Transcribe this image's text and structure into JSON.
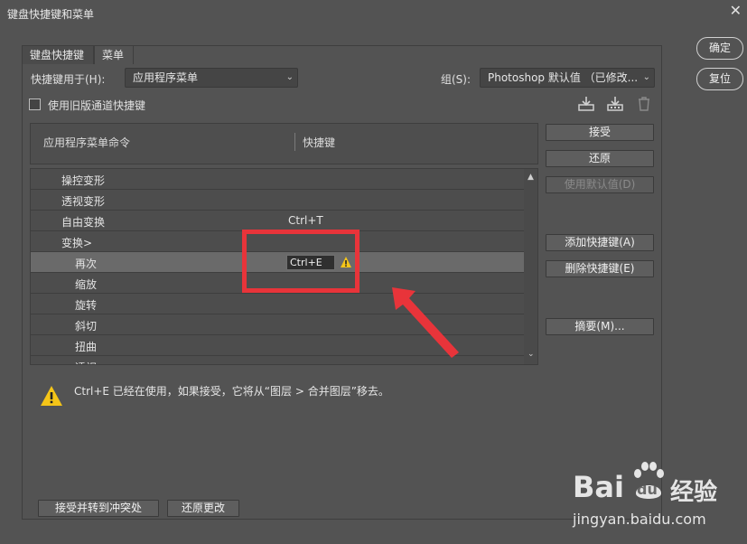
{
  "window": {
    "title": "键盘快捷键和菜单"
  },
  "tabs": [
    {
      "label": "键盘快捷键",
      "active": true
    },
    {
      "label": "菜单",
      "active": false
    }
  ],
  "shortcuts_for": {
    "label": "快捷键用于(H):",
    "value": "应用程序菜单"
  },
  "group": {
    "label": "组(S):",
    "value": "Photoshop 默认值 （已修改..."
  },
  "legacy_checkbox": {
    "label": "使用旧版通道快捷键",
    "checked": false
  },
  "table": {
    "col_command": "应用程序菜单命令",
    "col_shortcut": "快捷键",
    "rows": [
      {
        "command": "操控变形",
        "shortcut": "",
        "indent": 1
      },
      {
        "command": "透视变形",
        "shortcut": "",
        "indent": 1
      },
      {
        "command": "自由变换",
        "shortcut": "Ctrl+T",
        "indent": 1
      },
      {
        "command": "变换>",
        "shortcut": "",
        "indent": 1
      },
      {
        "command": "再次",
        "shortcut": "Ctrl+E",
        "indent": 2,
        "selected": true,
        "warning": true
      },
      {
        "command": "缩放",
        "shortcut": "",
        "indent": 2
      },
      {
        "command": "旋转",
        "shortcut": "",
        "indent": 2
      },
      {
        "command": "斜切",
        "shortcut": "",
        "indent": 2
      },
      {
        "command": "扭曲",
        "shortcut": "",
        "indent": 2
      },
      {
        "command": "透视",
        "shortcut": "",
        "indent": 2
      }
    ]
  },
  "side_buttons": {
    "accept": "接受",
    "undo": "还原",
    "use_default": "使用默认值(D)",
    "add_shortcut": "添加快捷键(A)",
    "delete_shortcut": "删除快捷键(E)",
    "summary": "摘要(M)..."
  },
  "dialog_buttons": {
    "ok": "确定",
    "reset": "复位"
  },
  "bottom_buttons": {
    "accept_goto_conflict": "接受并转到冲突处",
    "undo_changes": "还原更改"
  },
  "message": "Ctrl+E 已经在使用，如果接受，它将从“图层 > 合并图层”移去。",
  "watermark": {
    "brand": "Bai",
    "paw": "du",
    "suffix": "经验",
    "url": "jingyan.baidu.com"
  },
  "colors": {
    "highlight": "#e8343a",
    "warning": "#f5c518",
    "background": "#535353"
  }
}
